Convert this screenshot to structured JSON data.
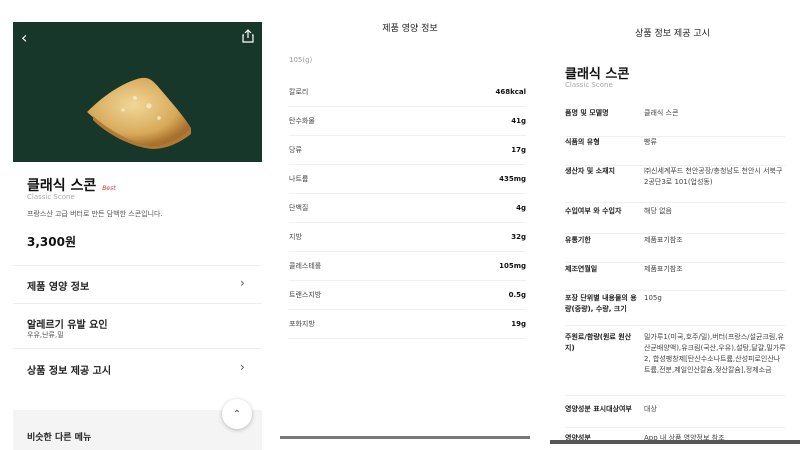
{
  "product_page": {
    "title": "클래식 스콘",
    "badge": "Best",
    "english_name": "Classic Scone",
    "description": "프랑스산 고급 버터로 만든 담백한 스콘입니다.",
    "price": "3,300원",
    "nutrition_label": "제품 영양 정보",
    "allergy_label": "알레르기 유발 요인",
    "allergy_items": "우유,난류,밀",
    "notice_label": "상품 정보 제공 고시",
    "similar_label": "비슷한 다른 메뉴"
  },
  "nutrition_page": {
    "title": "제품 영양 정보",
    "serving": "105(g)",
    "rows": [
      {
        "label": "칼로리",
        "value": "468kcal"
      },
      {
        "label": "탄수화물",
        "value": "41g"
      },
      {
        "label": "당류",
        "value": "17g"
      },
      {
        "label": "나트륨",
        "value": "435mg"
      },
      {
        "label": "단백질",
        "value": "4g"
      },
      {
        "label": "지방",
        "value": "32g"
      },
      {
        "label": "콜레스테롤",
        "value": "105mg"
      },
      {
        "label": "트랜스지방",
        "value": "0.5g"
      },
      {
        "label": "포화지방",
        "value": "19g"
      }
    ]
  },
  "notice_page": {
    "title": "상품 정보 제공 고시",
    "product_name": "클래식 스콘",
    "english_name": "Classic Scone",
    "rows": [
      {
        "label": "품명 및 모델명",
        "value": "클래식 스콘"
      },
      {
        "label": "식품의 유형",
        "value": "빵류"
      },
      {
        "label": "생산자 및 소재지",
        "value": "㈜신세계푸드 천안공장/충청남도 천안시 서북구 2공단3로 101(업성동)"
      },
      {
        "label": "수입여부 와 수입자",
        "value": "해당 없음"
      },
      {
        "label": "유통기한",
        "value": "제품표기참조"
      },
      {
        "label": "제조연월일",
        "value": "제품표기참조"
      },
      {
        "label": "포장 단위별 내용물의 용량(중량), 수량, 크기",
        "value": "105g"
      },
      {
        "label": "주원료/함량(원료 원산지)",
        "value": "밀가루1(미국,호주/밀),버터(프랑스/설균크림,유산균배양액),유크림(국산,우유),설탕,달걀,밀가루2, 합성팽창제[탄산수소나트륨,산성피로인산나트륨,전분,제일인산칼슘,젖산칼슘],정제소금"
      },
      {
        "label": "영양성분 표시대상여부",
        "value": "대상"
      },
      {
        "label": "영양성분",
        "value": "App 내 상품 영양정보 참조"
      }
    ]
  },
  "colors": {
    "hero_bg": "#17372b",
    "badge": "#d23b2b"
  },
  "icons": {
    "back": "chevron-left-icon",
    "share": "share-icon",
    "row_arrow": "chevron-right-icon",
    "scroll_top": "chevron-up-icon"
  }
}
